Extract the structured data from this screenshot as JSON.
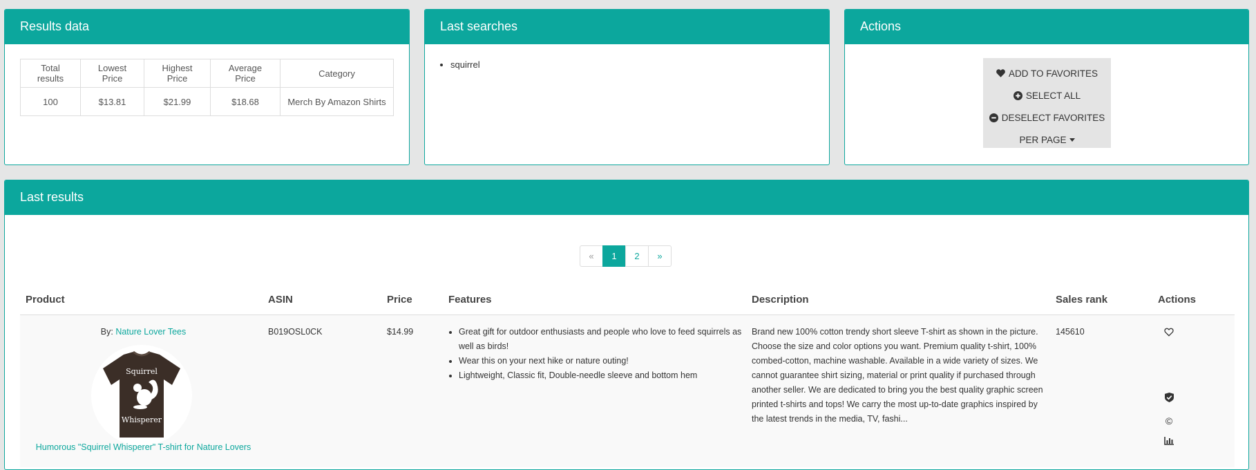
{
  "results_data": {
    "title": "Results data",
    "headers": [
      "Total results",
      "Lowest Price",
      "Highest Price",
      "Average Price",
      "Category"
    ],
    "values": [
      "100",
      "$13.81",
      "$21.99",
      "$18.68",
      "Merch By Amazon Shirts"
    ]
  },
  "last_searches": {
    "title": "Last searches",
    "items": [
      "squirrel"
    ]
  },
  "actions": {
    "title": "Actions",
    "add_favorites": "ADD TO FAVORITES",
    "select_all": "SELECT ALL",
    "deselect_favorites": "DESELECT FAVORITES",
    "per_page": "PER PAGE"
  },
  "last_results": {
    "title": "Last results",
    "pagination": {
      "prev": "«",
      "pages": [
        "1",
        "2"
      ],
      "next": "»",
      "active": "1"
    },
    "columns": [
      "Product",
      "ASIN",
      "Price",
      "Features",
      "Description",
      "Sales rank",
      "Actions"
    ],
    "rows": [
      {
        "by_label": "By:",
        "brand": "Nature Lover Tees",
        "shirt_text_1": "Squirrel",
        "shirt_text_2": "Whisperer",
        "product_title": "Humorous \"Squirrel Whisperer\" T-shirt for Nature Lovers",
        "asin": "B019OSL0CK",
        "price": "$14.99",
        "features": [
          "Great gift for outdoor enthusiasts and people who love to feed squirrels as well as birds!",
          "Wear this on your next hike or nature outing!",
          "Lightweight, Classic fit, Double-needle sleeve and bottom hem"
        ],
        "description": "Brand new 100% cotton trendy short sleeve T-shirt as shown in the picture. Choose the size and color options you want. Premium quality t-shirt, 100% combed-cotton, machine washable. Available in a wide variety of sizes. We cannot guarantee shirt sizing, material or print quality if purchased through another seller. We are dedicated to bring you the best quality graphic screen printed t-shirts and tops! We carry the most up-to-date graphics inspired by the latest trends in the media, TV, fashi...",
        "sales_rank": "145610",
        "copyright_symbol": "©"
      }
    ]
  },
  "colors": {
    "accent": "#0ca79d",
    "background": "#e5e6e6",
    "shirt": "#3b2e27"
  },
  "icons": [
    "heart-icon",
    "plus-circle-icon",
    "minus-circle-icon",
    "caret-down-icon",
    "heart-outline-icon",
    "shield-check-icon",
    "copyright-icon",
    "bar-chart-icon"
  ]
}
